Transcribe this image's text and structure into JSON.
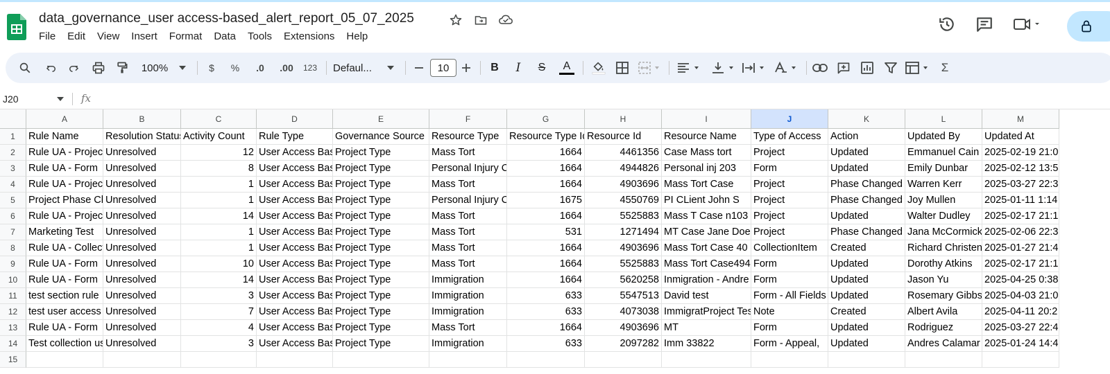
{
  "document": {
    "title": "data_governance_user access-based_alert_report_05_07_2025"
  },
  "menu": [
    "File",
    "Edit",
    "View",
    "Insert",
    "Format",
    "Data",
    "Tools",
    "Extensions",
    "Help"
  ],
  "toolbar": {
    "zoom": "100%",
    "currency": "$",
    "percent": "%",
    "decrease_decimal": ".0",
    "increase_decimal": ".00",
    "number_format": "123",
    "font": "Defaul...",
    "font_size": "10",
    "bold": "B",
    "italic": "I",
    "strike": "S",
    "text_color": "A",
    "sum": "Σ"
  },
  "formula_bar": {
    "name_box": "J20",
    "fx": "fx"
  },
  "columns": [
    "A",
    "B",
    "C",
    "D",
    "E",
    "F",
    "G",
    "H",
    "I",
    "J",
    "K",
    "L",
    "M"
  ],
  "selected_column": "J",
  "rows": [
    [
      "Rule Name",
      "Resolution Status",
      "Activity Count",
      "Rule Type",
      "Governance Source",
      "Resource Type",
      "Resource Type Id",
      "Resource Id",
      "Resource Name",
      "Type of Access",
      "Action",
      "Updated By",
      "Updated At"
    ],
    [
      "Rule UA - Project",
      "Unresolved",
      "12",
      "User Access Based",
      "Project Type",
      "Mass Tort",
      "1664",
      "4461356",
      "Case Mass tort",
      "Project",
      "Updated",
      "Emmanuel Cain",
      "2025-02-19 21:0"
    ],
    [
      "Rule UA - Form",
      "Unresolved",
      "8",
      "User Access Based",
      "Project Type",
      "Personal Injury Case",
      "1664",
      "4944826",
      "Personal inj 203",
      "Form",
      "Updated",
      "Emily Dunbar",
      "2025-02-12 13:5"
    ],
    [
      "Rule UA - Project",
      "Unresolved",
      "1",
      "User Access Based",
      "Project Type",
      "Mass Tort",
      "1664",
      "4903696",
      "Mass Tort Case",
      "Project",
      "Phase Changed",
      "Warren Kerr",
      "2025-03-27 22:3"
    ],
    [
      "Project Phase Change",
      "Unresolved",
      "1",
      "User Access Based",
      "Project Type",
      "Personal Injury Case",
      "1675",
      "4550769",
      "PI CLient John S",
      "Project",
      "Phase Changed",
      "Joy Mullen",
      "2025-01-11 1:14"
    ],
    [
      "Rule UA - Project",
      "Unresolved",
      "14",
      "User Access Based",
      "Project Type",
      "Mass Tort",
      "1664",
      "5525883",
      "Mass T Case n103",
      "Project",
      "Updated",
      "Walter Dudley",
      "2025-02-17 21:1"
    ],
    [
      "Marketing Test",
      "Unresolved",
      "1",
      "User Access Based",
      "Project Type",
      "Mass Tort",
      "531",
      "1271494",
      "MT Case Jane Doe",
      "Project",
      "Phase Changed",
      "Jana McCormick",
      "2025-02-06 22:3"
    ],
    [
      "Rule UA - Collection",
      "Unresolved",
      "1",
      "User Access Based",
      "Project Type",
      "Mass Tort",
      "1664",
      "4903696",
      "Mass Tort Case 40",
      "CollectionItem",
      "Created",
      "Richard Christensen",
      "2025-01-27 21:4"
    ],
    [
      "Rule UA - Form",
      "Unresolved",
      "10",
      "User Access Based",
      "Project Type",
      "Mass Tort",
      "1664",
      "5525883",
      "Mass Tort Case494",
      "Form",
      "Updated",
      "Dorothy Atkins",
      "2025-02-17 21:1"
    ],
    [
      "Rule UA - Form",
      "Unresolved",
      "14",
      "User Access Based",
      "Project Type",
      "Immigration",
      "1664",
      "5620258",
      "Inmigration - Andre",
      "Form",
      "Updated",
      "Jason Yu",
      "2025-04-25 0:38"
    ],
    [
      "test section rule",
      "Unresolved",
      "3",
      "User Access Based",
      "Project Type",
      "Immigration",
      "633",
      "5547513",
      "David test",
      "Form - All  Fields",
      "Updated",
      "Rosemary Gibbs",
      "2025-04-03 21:0"
    ],
    [
      "test user access",
      "Unresolved",
      "7",
      "User Access Based",
      "Project Type",
      "Immigration",
      "633",
      "4073038",
      "ImmigratProject Test",
      "Note",
      "Created",
      "Albert Avila",
      "2025-04-11 20:2"
    ],
    [
      "Rule UA - Form",
      "Unresolved",
      "4",
      "User Access Based",
      "Project Type",
      "Mass Tort",
      "1664",
      "4903696",
      "MT",
      "Form",
      "Updated",
      "Rodriguez",
      "2025-03-27 22:4"
    ],
    [
      "Test collection user",
      "Unresolved",
      "3",
      "User Access Based",
      "Project Type",
      "Immigration",
      "633",
      "2097282",
      "Imm 33822",
      "Form - Appeal,",
      "Updated",
      "Andres Calamar",
      "2025-01-24 14:4"
    ],
    [
      "",
      "",
      "",
      "",
      "",
      "",
      "",
      "",
      "",
      "",
      "",
      "",
      ""
    ]
  ],
  "colors": {
    "accent": "#0b57d0",
    "toolbar_bg": "#edf2fa",
    "selected_header": "#d3e3fd",
    "sheets_green": "#0f9d58"
  }
}
